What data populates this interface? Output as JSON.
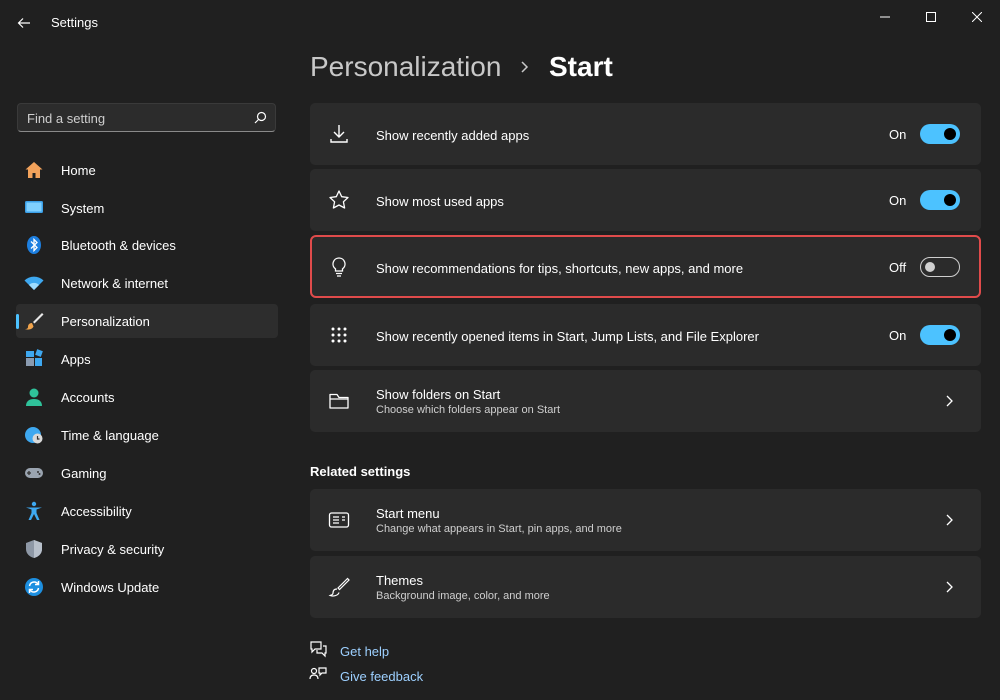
{
  "window": {
    "title": "Settings",
    "controls": [
      "minimize",
      "maximize",
      "close"
    ]
  },
  "search": {
    "placeholder": "Find a setting"
  },
  "sidebar": {
    "items": [
      {
        "label": "Home",
        "icon": "home-icon"
      },
      {
        "label": "System",
        "icon": "system-icon"
      },
      {
        "label": "Bluetooth & devices",
        "icon": "bluetooth-icon"
      },
      {
        "label": "Network & internet",
        "icon": "wifi-icon"
      },
      {
        "label": "Personalization",
        "icon": "brush-icon",
        "active": true
      },
      {
        "label": "Apps",
        "icon": "apps-icon"
      },
      {
        "label": "Accounts",
        "icon": "person-icon"
      },
      {
        "label": "Time & language",
        "icon": "globe-clock-icon"
      },
      {
        "label": "Gaming",
        "icon": "gamepad-icon"
      },
      {
        "label": "Accessibility",
        "icon": "accessibility-icon"
      },
      {
        "label": "Privacy & security",
        "icon": "shield-icon"
      },
      {
        "label": "Windows Update",
        "icon": "update-icon"
      }
    ]
  },
  "breadcrumb": {
    "parent": "Personalization",
    "current": "Start"
  },
  "settings": [
    {
      "title": "Show recently added apps",
      "state": "On",
      "icon": "download-icon"
    },
    {
      "title": "Show most used apps",
      "state": "On",
      "icon": "star-icon"
    },
    {
      "title": "Show recommendations for tips, shortcuts, new apps, and more",
      "state": "Off",
      "icon": "lightbulb-icon",
      "highlighted": true
    },
    {
      "title": "Show recently opened items in Start, Jump Lists, and File Explorer",
      "state": "On",
      "icon": "grid-icon"
    },
    {
      "title": "Show folders on Start",
      "subtitle": "Choose which folders appear on Start",
      "icon": "folder-icon"
    }
  ],
  "related": {
    "heading": "Related settings",
    "items": [
      {
        "title": "Start menu",
        "subtitle": "Change what appears in Start, pin apps, and more",
        "icon": "start-menu-icon"
      },
      {
        "title": "Themes",
        "subtitle": "Background image, color, and more",
        "icon": "brush-icon"
      }
    ]
  },
  "links": {
    "help": "Get help",
    "feedback": "Give feedback"
  },
  "colors": {
    "accent": "#4cc2ff",
    "highlight": "#e04b4b",
    "background": "#202020",
    "card": "#2b2b2b"
  }
}
